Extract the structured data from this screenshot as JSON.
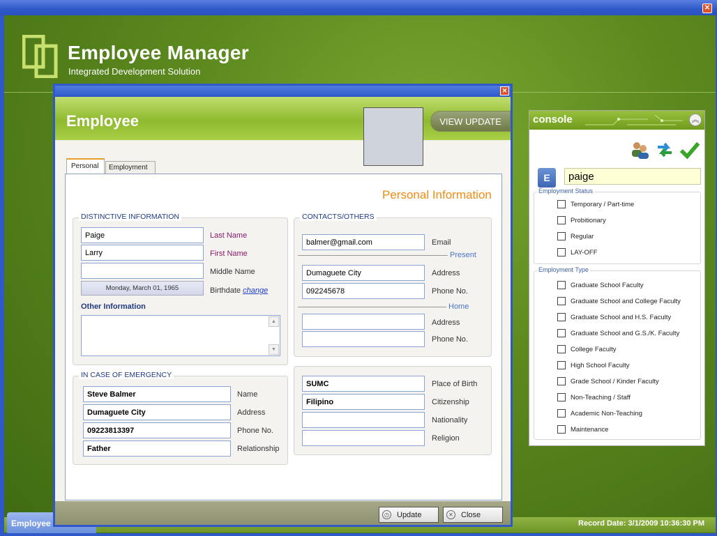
{
  "app": {
    "title": "Employee Manager",
    "subtitle": "Integrated Development Solution",
    "taskbar_tab": "Employee",
    "record_date": "Record Date: 3/1/2009 10:36:30 PM",
    "brand_color": "#6f9a1c"
  },
  "console": {
    "title": "console",
    "search_value": "paige",
    "search_icon_letter": "E",
    "status_legend": "Employment Status",
    "status_items": [
      "Temporary / Part-time",
      "Probitionary",
      "Regular",
      "LAY-OFF"
    ],
    "type_legend": "Employment Type",
    "type_items": [
      "Graduate School Faculty",
      "Graduate School and College Faculty",
      "Graduate School and H.S. Faculty",
      "Graduate School and G.S./K. Faculty",
      "College Faculty",
      "High School Faculty",
      "Grade School / Kinder Faculty",
      "Non-Teaching / Staff",
      "Academic Non-Teaching",
      "Maintenance"
    ],
    "tools": [
      "users-icon",
      "refresh-icon",
      "check-icon"
    ]
  },
  "dialog": {
    "title": "Employee",
    "view_update": "VIEW UPDATE",
    "tabs": [
      "Personal",
      "Employment"
    ],
    "section_title": "Personal Information",
    "distinctive": {
      "title": "DISTINCTIVE INFORMATION",
      "last_name": "Paige",
      "last_name_label": "Last Name",
      "first_name": "Larry",
      "first_name_label": "First Name",
      "middle_name": "",
      "middle_name_label": "Middle Name",
      "birthdate": "Monday, March 01, 1965",
      "birthdate_label": "Birthdate",
      "change_link": "change",
      "other_info_label": "Other Information",
      "other_info": ""
    },
    "contacts": {
      "title": "CONTACTS/OTHERS",
      "email": "balmer@gmail.com",
      "email_label": "Email",
      "present_label": "Present",
      "present_address": "Dumaguete City",
      "present_address_label": "Address",
      "present_phone": "092245678",
      "present_phone_label": "Phone No.",
      "home_label": "Home",
      "home_address": "",
      "home_address_label": "Address",
      "home_phone": "",
      "home_phone_label": "Phone No."
    },
    "emergency": {
      "title": "IN CASE OF EMERGENCY",
      "name": "Steve Balmer",
      "name_label": "Name",
      "address": "Dumaguete City",
      "address_label": "Address",
      "phone": "09223813397",
      "phone_label": "Phone No.",
      "relationship": "Father",
      "relationship_label": "Relationship"
    },
    "others": {
      "place_of_birth": "SUMC",
      "place_of_birth_label": "Place of Birth",
      "citizenship": "Filipino",
      "citizenship_label": "Citizenship",
      "nationality": "",
      "nationality_label": "Nationality",
      "religion": "",
      "religion_label": "Religion"
    },
    "buttons": {
      "update": "Update",
      "close": "Close"
    }
  }
}
